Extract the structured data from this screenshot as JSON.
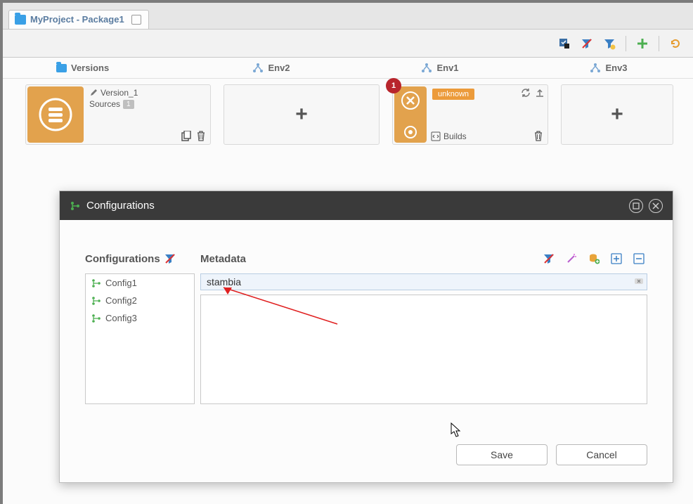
{
  "tab": {
    "title": "MyProject - Package1"
  },
  "toolbar": {},
  "columns": {
    "versions": "Versions",
    "envs": [
      "Env2",
      "Env1",
      "Env3"
    ]
  },
  "version_card": {
    "name": "Version_1",
    "sources_label": "Sources",
    "sources_count": "1"
  },
  "env_card": {
    "status": "unknown",
    "builds_label": "Builds",
    "badge": "1"
  },
  "dialog": {
    "title": "Configurations",
    "cfg_label": "Configurations",
    "meta_label": "Metadata",
    "configs": [
      "Config1",
      "Config2",
      "Config3"
    ],
    "meta_input": "stambia",
    "save": "Save",
    "cancel": "Cancel"
  }
}
